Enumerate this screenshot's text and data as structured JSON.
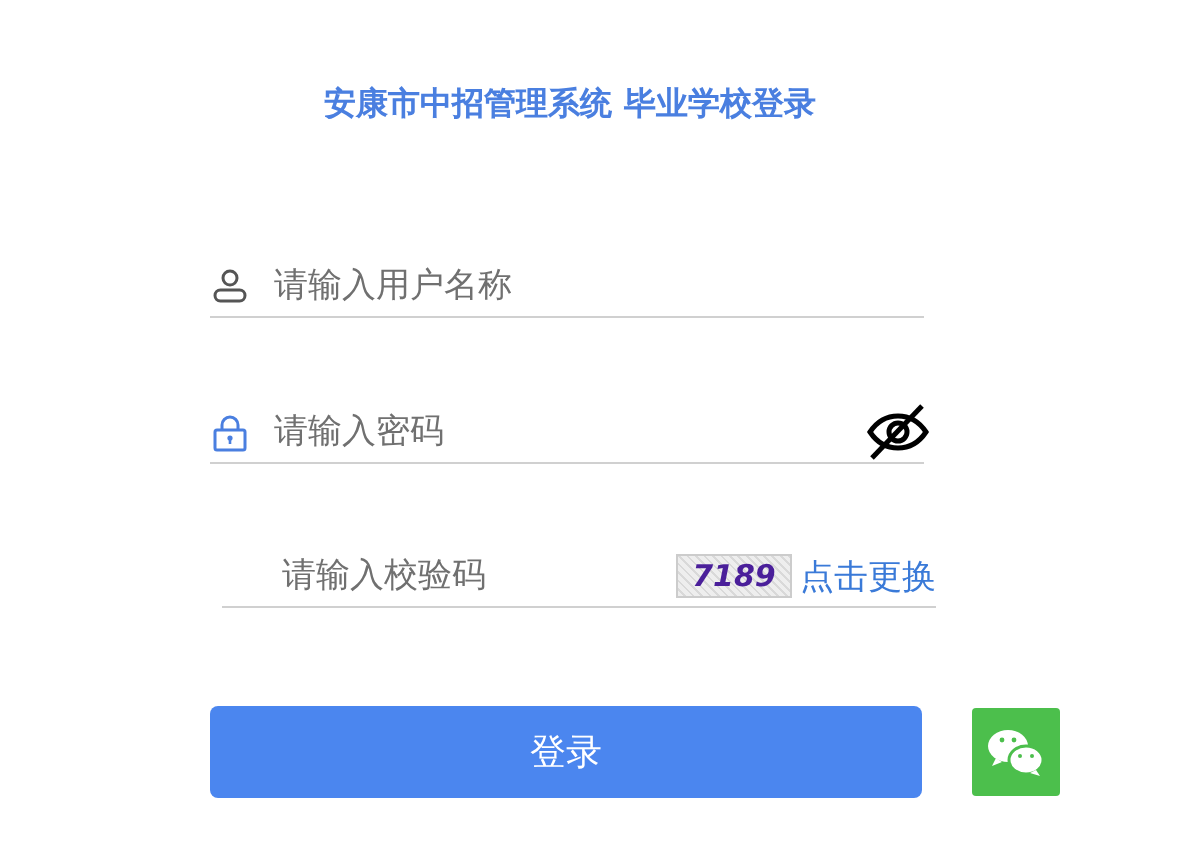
{
  "title": "安康市中招管理系统 毕业学校登录",
  "username": {
    "placeholder": "请输入用户名称"
  },
  "password": {
    "placeholder": "请输入密码",
    "visible": false
  },
  "captcha": {
    "placeholder": "请输入校验码",
    "code": "7189",
    "refresh": "点击更换"
  },
  "login_button": "登录"
}
